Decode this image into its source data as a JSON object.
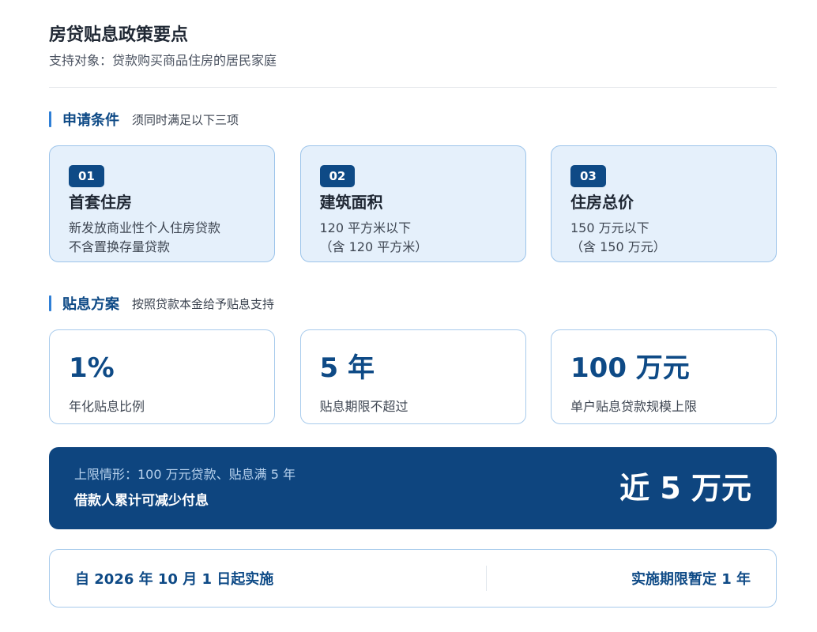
{
  "header": {
    "title": "房贷贴息政策要点",
    "subtitle": "支持对象：贷款购买商品住房的居民家庭"
  },
  "conditions": {
    "label": "申请条件",
    "note": "须同时满足以下三项",
    "cards": [
      {
        "badge": "01",
        "title": "首套住房",
        "desc": "新发放商业性个人住房贷款\n不含置换存量贷款"
      },
      {
        "badge": "02",
        "title": "建筑面积",
        "desc": "120 平方米以下\n（含 120 平方米）"
      },
      {
        "badge": "03",
        "title": "住房总价",
        "desc": "150 万元以下\n（含 150 万元）"
      }
    ]
  },
  "plan": {
    "label": "贴息方案",
    "note": "按照贷款本金给予贴息支持",
    "cards": [
      {
        "value": "1%",
        "desc": "年化贴息比例"
      },
      {
        "value": "5 年",
        "desc": "贴息期限不超过"
      },
      {
        "value": "100 万元",
        "desc": "单户贴息贷款规模上限"
      }
    ]
  },
  "highlight": {
    "line1": "上限情形：100 万元贷款、贴息满 5 年",
    "line2": "借款人累计可减少付息",
    "value": "近 5 万元"
  },
  "footer": {
    "start": "自 2026 年 10 月 1 日起实施",
    "period": "实施期限暂定 1 年"
  },
  "colors": {
    "accent": "#0e4a86",
    "accent_bar": "#2f7fd6",
    "card_bg": "#e5f0fb",
    "card_border": "#9cc4ea",
    "highlight_bg": "#0e457f"
  }
}
